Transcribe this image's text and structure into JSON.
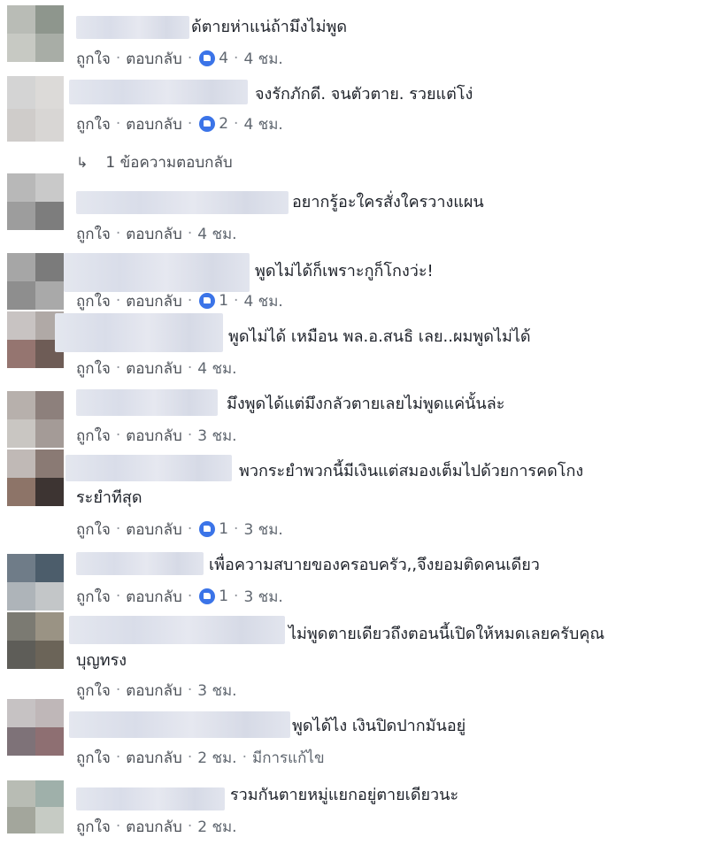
{
  "actions": {
    "like": "ถูกใจ",
    "reply": "ตอบกลับ",
    "edited": "มีการแก้ไข",
    "dot": "·"
  },
  "reply_link": "1 ข้อความตอบกลับ",
  "comments": [
    {
      "text": "ด้ตายห่าแน่ถ้ามึงไม่พูด",
      "likes": "4",
      "time": "4 ชม."
    },
    {
      "text": "จงรักภักดี. จนตัวตาย. รวยแต่โง่",
      "likes": "2",
      "time": "4 ชม."
    },
    {
      "text": "อยากรู้อะใครสั่งใครวางแผน",
      "likes": "",
      "time": "4 ชม."
    },
    {
      "text": "พูดไม่ได้ก็เพราะกูก็โกงว่ะ!",
      "likes": "1",
      "time": "4 ชม."
    },
    {
      "text": "พูดไม่ได้ เหมือน พล.อ.สนธิ เลย..ผมพูดไม่ได้",
      "likes": "",
      "time": "4 ชม."
    },
    {
      "text": "มึงพูดได้แต่มึงกลัวตายเลยไม่พูดแค่นั้นล่ะ",
      "likes": "",
      "time": "3 ชม."
    },
    {
      "text": "พวกระยำพวกนี้มีเงินแต่สมองเต็มไปด้วยการคดโกง",
      "text2": "ระยำทีสุด",
      "likes": "1",
      "time": "3 ชม."
    },
    {
      "text": "เพื่อความสบายของครอบครัว,,จึงยอมติดคนเดียว",
      "likes": "1",
      "time": "3 ชม."
    },
    {
      "text": "ไม่พูดตายเดียวถึงตอนนี้เปิดให้หมดเลยครับคุณ",
      "text2": "บุญทรง",
      "likes": "",
      "time": "3 ชม."
    },
    {
      "text": "พูดได้ไง เงินปิดปากมันอยู่",
      "likes": "",
      "time": "2 ชม.",
      "edited": true
    },
    {
      "text": "รวมกันตายหมู่แยกอยู่ตายเดียวนะ",
      "likes": "",
      "time": "2 ชม."
    }
  ],
  "colors": {
    "like_blue": "#3b74e8",
    "meta_gray": "#606770"
  }
}
